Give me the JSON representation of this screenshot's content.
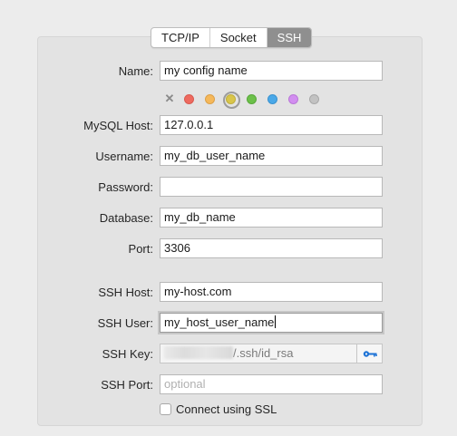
{
  "tabs": [
    {
      "label": "TCP/IP",
      "active": false
    },
    {
      "label": "Socket",
      "active": false
    },
    {
      "label": "SSH",
      "active": true
    }
  ],
  "fields": {
    "name": {
      "label": "Name:",
      "value": "my config name"
    },
    "mysql_host": {
      "label": "MySQL Host:",
      "value": "127.0.0.1"
    },
    "username": {
      "label": "Username:",
      "value": "my_db_user_name"
    },
    "password": {
      "label": "Password:",
      "value": ""
    },
    "database": {
      "label": "Database:",
      "value": "my_db_name"
    },
    "port": {
      "label": "Port:",
      "value": "3306"
    },
    "ssh_host": {
      "label": "SSH Host:",
      "value": "my-host.com"
    },
    "ssh_user": {
      "label": "SSH User:",
      "value": "my_host_user_name"
    },
    "ssh_key": {
      "label": "SSH Key:",
      "value": "/.ssh/id_rsa"
    },
    "ssh_port": {
      "label": "SSH Port:",
      "value": "",
      "placeholder": "optional"
    }
  },
  "color_tags": {
    "clear_icon": "x-icon",
    "colors": [
      "#ee6a5f",
      "#f5b85a",
      "#d9c54a",
      "#6cc04a",
      "#4aa8e8",
      "#d28ef0",
      "#c2c2c2"
    ],
    "selected_index": 2
  },
  "ssl": {
    "label": "Connect using SSL",
    "checked": false
  },
  "key_button_icon": "key-icon",
  "accent_color": "#1e73d6"
}
